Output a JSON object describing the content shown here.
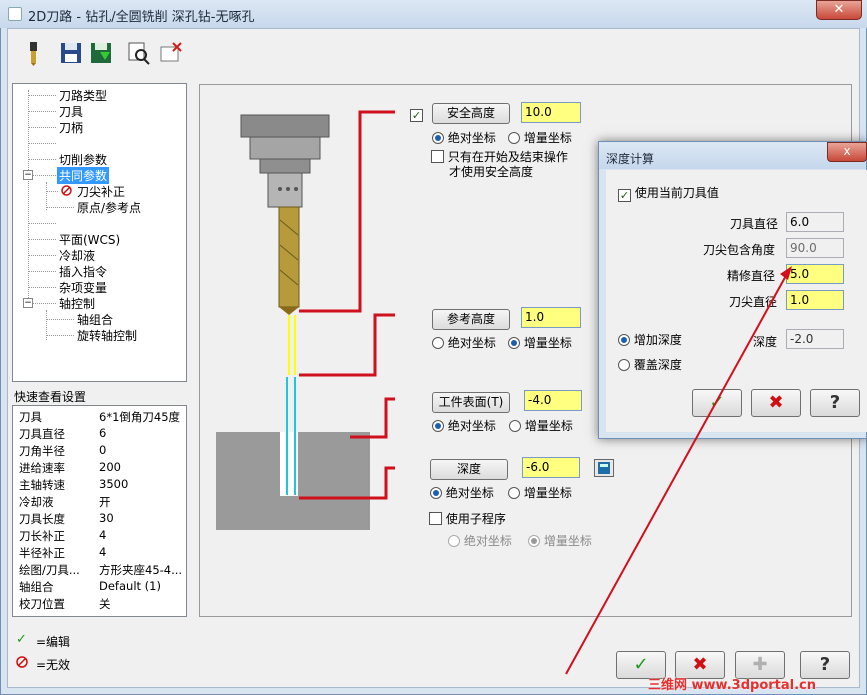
{
  "window": {
    "title": "2D刀路 - 钻孔/全圆铣削 深孔钻-无啄孔",
    "close": "✕"
  },
  "toolbar": {
    "icons": [
      "tool-icon",
      "save-icon",
      "save-as-icon",
      "view-icon",
      "delete-icon"
    ]
  },
  "tree": {
    "items": [
      {
        "label": "刀路类型"
      },
      {
        "label": "刀具"
      },
      {
        "label": "刀柄"
      },
      {
        "label": "切削参数"
      },
      {
        "label": "共同参数"
      },
      {
        "label": "刀尖补正"
      },
      {
        "label": "原点/参考点"
      },
      {
        "label": "平面(WCS)"
      },
      {
        "label": "冷却液"
      },
      {
        "label": "插入指令"
      },
      {
        "label": "杂项变量"
      },
      {
        "label": "轴控制"
      },
      {
        "label": "轴组合"
      },
      {
        "label": "旋转轴控制"
      }
    ]
  },
  "quickview": {
    "title": "快速查看设置",
    "rows": [
      {
        "k": "刀具",
        "v": "6*1倒角刀45度"
      },
      {
        "k": "刀具直径",
        "v": "6"
      },
      {
        "k": "刀角半径",
        "v": "0"
      },
      {
        "k": "进给速率",
        "v": "200"
      },
      {
        "k": "主轴转速",
        "v": "3500"
      },
      {
        "k": "冷却液",
        "v": "开"
      },
      {
        "k": "刀具长度",
        "v": "30"
      },
      {
        "k": "刀长补正",
        "v": "4"
      },
      {
        "k": "半径补正",
        "v": "4"
      },
      {
        "k": "绘图/刀具...",
        "v": "方形夹座45-4..."
      },
      {
        "k": "轴组合",
        "v": "Default (1)"
      },
      {
        "k": "校刀位置",
        "v": "关"
      }
    ]
  },
  "legend": {
    "edit": "=编辑",
    "invalid": "=无效"
  },
  "params": {
    "clearance": {
      "btn": "安全高度",
      "value": "10.0",
      "abs": "绝对坐标",
      "inc": "增量坐标",
      "only": "只有在开始及结束操作",
      "only2": "才使用安全高度"
    },
    "retract": {
      "btn": "参考高度",
      "value": "1.0",
      "abs": "绝对坐标",
      "inc": "增量坐标"
    },
    "top": {
      "btn": "工件表面(T)",
      "value": "-4.0",
      "abs": "绝对坐标",
      "inc": "增量坐标"
    },
    "depth": {
      "btn": "深度",
      "value": "-6.0",
      "abs": "绝对坐标",
      "inc": "增量坐标"
    },
    "subprog": {
      "label": "使用子程序",
      "abs": "绝对坐标",
      "inc": "增量坐标"
    }
  },
  "dialog": {
    "title": "深度计算",
    "close": "x",
    "use_current": "使用当前刀具值",
    "fields": [
      {
        "label": "刀具直径",
        "value": "6.0",
        "style": "plain"
      },
      {
        "label": "刀尖包含角度",
        "value": "90.0",
        "style": "disabled"
      },
      {
        "label": "精修直径",
        "value": "5.0",
        "style": "yellow"
      },
      {
        "label": "刀尖直径",
        "value": "1.0",
        "style": "yellow"
      }
    ],
    "add_depth": "增加深度",
    "override_depth": "覆盖深度",
    "depth_label": "深度",
    "depth_value": "-2.0"
  },
  "watermark": "三维网 www.3dportal.cn",
  "colors": {
    "accent_red": "#d0101c",
    "yellow": "#ffff80",
    "cyan": "#22c5e0"
  }
}
